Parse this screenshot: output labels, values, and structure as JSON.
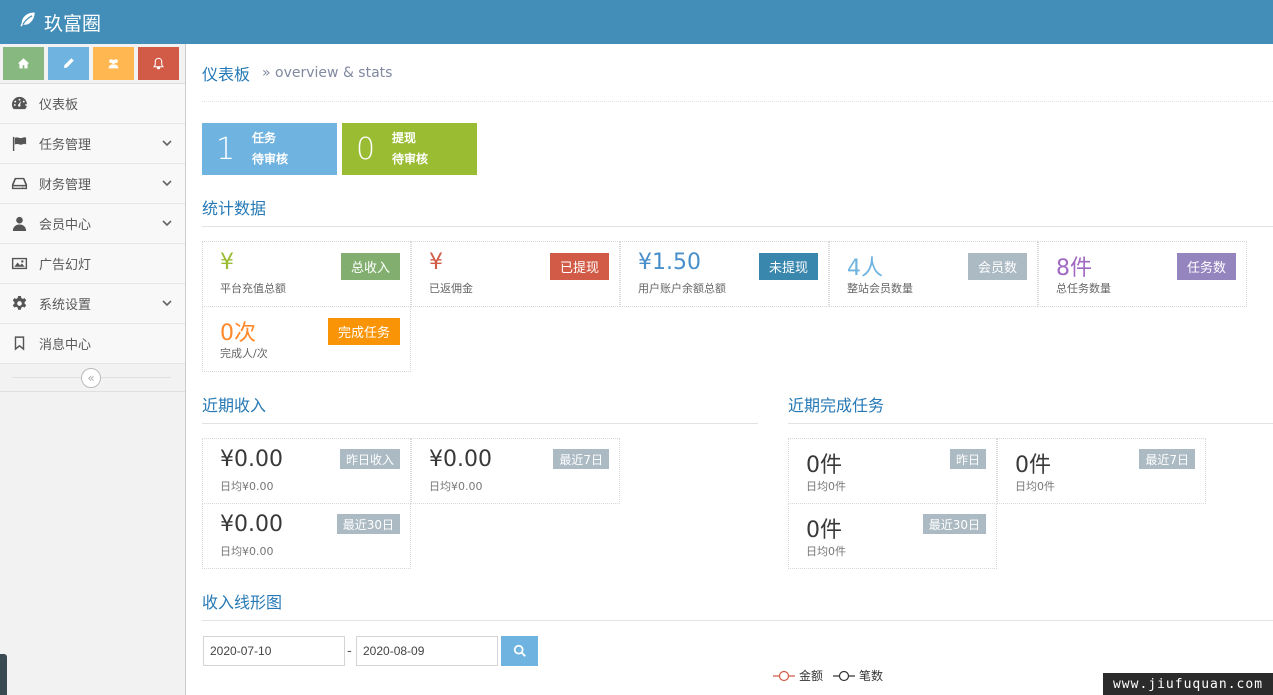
{
  "app": {
    "brand": "玖富圈"
  },
  "sidebar": {
    "shortcuts": [
      {
        "icon": "home-icon",
        "color": "#87b87f"
      },
      {
        "icon": "pencil-icon",
        "color": "#6fb3e0"
      },
      {
        "icon": "users-icon",
        "color": "#ffb752"
      },
      {
        "icon": "bell-icon",
        "color": "#d15b47"
      }
    ],
    "items": [
      {
        "label": "仪表板",
        "icon": "dashboard-icon",
        "has_arrow": false
      },
      {
        "label": "任务管理",
        "icon": "flag-icon",
        "has_arrow": true
      },
      {
        "label": "财务管理",
        "icon": "hdd-icon",
        "has_arrow": true
      },
      {
        "label": "会员中心",
        "icon": "user-icon",
        "has_arrow": true
      },
      {
        "label": "广告幻灯",
        "icon": "picture-icon",
        "has_arrow": false
      },
      {
        "label": "系统设置",
        "icon": "cog-icon",
        "has_arrow": true
      },
      {
        "label": "消息中心",
        "icon": "bookmark-icon",
        "has_arrow": false
      }
    ],
    "collapse_symbol": "«"
  },
  "header": {
    "title": "仪表板",
    "subtitle": "» overview & stats"
  },
  "infoboxes": [
    {
      "number": "1",
      "line1": "任务",
      "line2": "待审核",
      "color": "#6fb3e0"
    },
    {
      "number": "0",
      "line1": "提现",
      "line2": "待审核",
      "color": "#9abc32"
    }
  ],
  "sections": {
    "stats": "统计数据",
    "recent_income": "近期收入",
    "recent_tasks": "近期完成任务",
    "income_chart": "收入线形图"
  },
  "stats": [
    {
      "value": "¥",
      "desc": "平台充值总额",
      "badge": "总收入",
      "value_color": "#9abc32",
      "badge_color": "#82af6f"
    },
    {
      "value": "¥",
      "desc": "已返佣金",
      "badge": "已提现",
      "value_color": "#d15b47",
      "badge_color": "#d15b47"
    },
    {
      "value": "¥1.50",
      "desc": "用户账户余额总额",
      "badge": "未提现",
      "value_color": "#478fca",
      "badge_color": "#3a87ad"
    },
    {
      "value": "4人",
      "desc": "整站会员数量",
      "badge": "会员数",
      "value_color": "#6fb3e0",
      "badge_color": "#abbac3"
    },
    {
      "value": "8件",
      "desc": "总任务数量",
      "badge": "任务数",
      "value_color": "#a069c3",
      "badge_color": "#9585bf"
    },
    {
      "value": "0次",
      "desc": "完成人/次",
      "badge": "完成任务",
      "value_color": "#ff892a",
      "badge_color": "#f89406"
    }
  ],
  "income": [
    {
      "value": "¥0.00",
      "desc": "日均¥0.00",
      "tag": "昨日收入"
    },
    {
      "value": "¥0.00",
      "desc": "日均¥0.00",
      "tag": "最近7日"
    },
    {
      "value": "¥0.00",
      "desc": "日均¥0.00",
      "tag": "最近30日"
    }
  ],
  "tasks": [
    {
      "value": "0件",
      "desc": "日均0件",
      "tag": "昨日"
    },
    {
      "value": "0件",
      "desc": "日均0件",
      "tag": "最近7日"
    },
    {
      "value": "0件",
      "desc": "日均0件",
      "tag": "最近30日"
    }
  ],
  "filter": {
    "start_date": "2020-07-10",
    "separator": "-",
    "end_date": "2020-08-09"
  },
  "chart_legend": [
    {
      "name": "金额",
      "color": "#d15b47"
    },
    {
      "name": "笔数",
      "color": "#333333"
    }
  ],
  "watermark": "www.jiufuquan.com"
}
